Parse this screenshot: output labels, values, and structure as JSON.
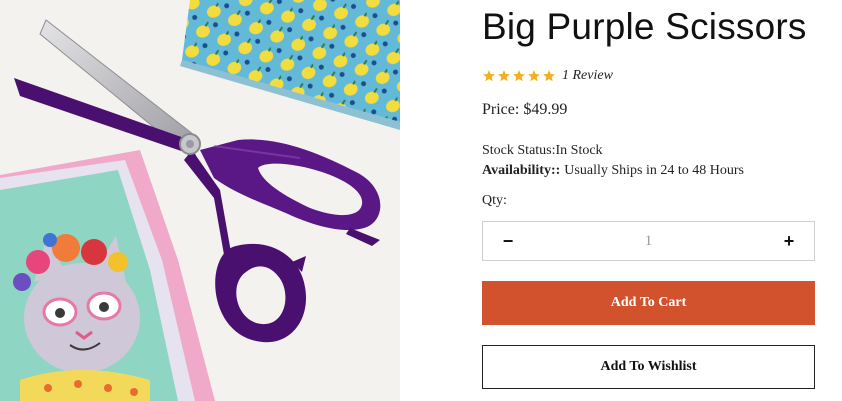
{
  "product": {
    "title": "Big Purple Scissors",
    "image_alt": "Purple fabric scissors on fabric",
    "rating": {
      "stars": 5,
      "max_stars": 5,
      "review_text": "1 Review"
    },
    "price": {
      "label": "Price:",
      "value": "$49.99"
    },
    "stock": {
      "text": "Stock Status:In Stock"
    },
    "availability": {
      "label": "Availability::",
      "value": "Usually Ships in 24 to 48 Hours"
    }
  },
  "quantity": {
    "label": "Qty:",
    "value": "1",
    "decrement_symbol": "−",
    "increment_symbol": "+"
  },
  "actions": {
    "add_to_cart": "Add To Cart",
    "add_to_wishlist": "Add To Wishlist"
  },
  "colors": {
    "accent": "#d3522e",
    "star": "#f2b01e",
    "scissors": "#4a1070"
  }
}
